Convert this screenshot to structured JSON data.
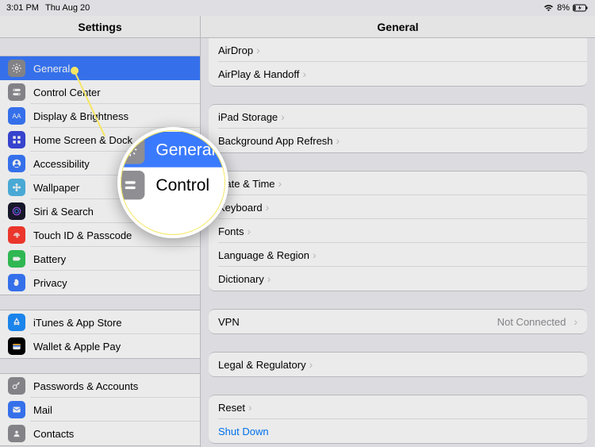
{
  "status": {
    "time": "3:01 PM",
    "date": "Thu Aug 20",
    "battery_pct": "8%"
  },
  "header": {
    "left": "Settings",
    "right": "General"
  },
  "sidebar": {
    "groups": [
      [
        {
          "label": "General",
          "icon": "gear",
          "bg": "#8e8e93",
          "selected": true
        },
        {
          "label": "Control Center",
          "icon": "switches",
          "bg": "#8e8e93"
        },
        {
          "label": "Display & Brightness",
          "icon": "sun",
          "bg": "#3a7afe"
        },
        {
          "label": "Home Screen & Dock",
          "icon": "grid",
          "bg": "#3b49df"
        },
        {
          "label": "Accessibility",
          "icon": "person",
          "bg": "#3a7afe"
        },
        {
          "label": "Wallpaper",
          "icon": "flower",
          "bg": "#50b8e8"
        },
        {
          "label": "Siri & Search",
          "icon": "siri",
          "bg": "#1a1a2e"
        },
        {
          "label": "Touch ID & Passcode",
          "icon": "fingerprint",
          "bg": "#ff3b30"
        },
        {
          "label": "Battery",
          "icon": "battery",
          "bg": "#34c759"
        },
        {
          "label": "Privacy",
          "icon": "hand",
          "bg": "#3a7afe"
        }
      ],
      [
        {
          "label": "iTunes & App Store",
          "icon": "appstore",
          "bg": "#1e90ff"
        },
        {
          "label": "Wallet & Apple Pay",
          "icon": "wallet",
          "bg": "#000"
        }
      ],
      [
        {
          "label": "Passwords & Accounts",
          "icon": "key",
          "bg": "#8e8e93"
        },
        {
          "label": "Mail",
          "icon": "mail",
          "bg": "#3a7afe"
        },
        {
          "label": "Contacts",
          "icon": "contact",
          "bg": "#8e8e93"
        }
      ]
    ]
  },
  "detail": {
    "groups": [
      [
        {
          "label": "AirDrop"
        },
        {
          "label": "AirPlay & Handoff"
        }
      ],
      [
        {
          "label": "iPad Storage"
        },
        {
          "label": "Background App Refresh"
        }
      ],
      [
        {
          "label": "Date & Time"
        },
        {
          "label": "Keyboard"
        },
        {
          "label": "Fonts"
        },
        {
          "label": "Language & Region"
        },
        {
          "label": "Dictionary"
        }
      ],
      [
        {
          "label": "VPN",
          "value": "Not Connected"
        }
      ],
      [
        {
          "label": "Legal & Regulatory"
        }
      ],
      [
        {
          "label": "Reset"
        },
        {
          "label": "Shut Down",
          "link": true,
          "nochevron": true
        }
      ]
    ]
  },
  "magnifier": {
    "general": "General",
    "control": "Control"
  }
}
